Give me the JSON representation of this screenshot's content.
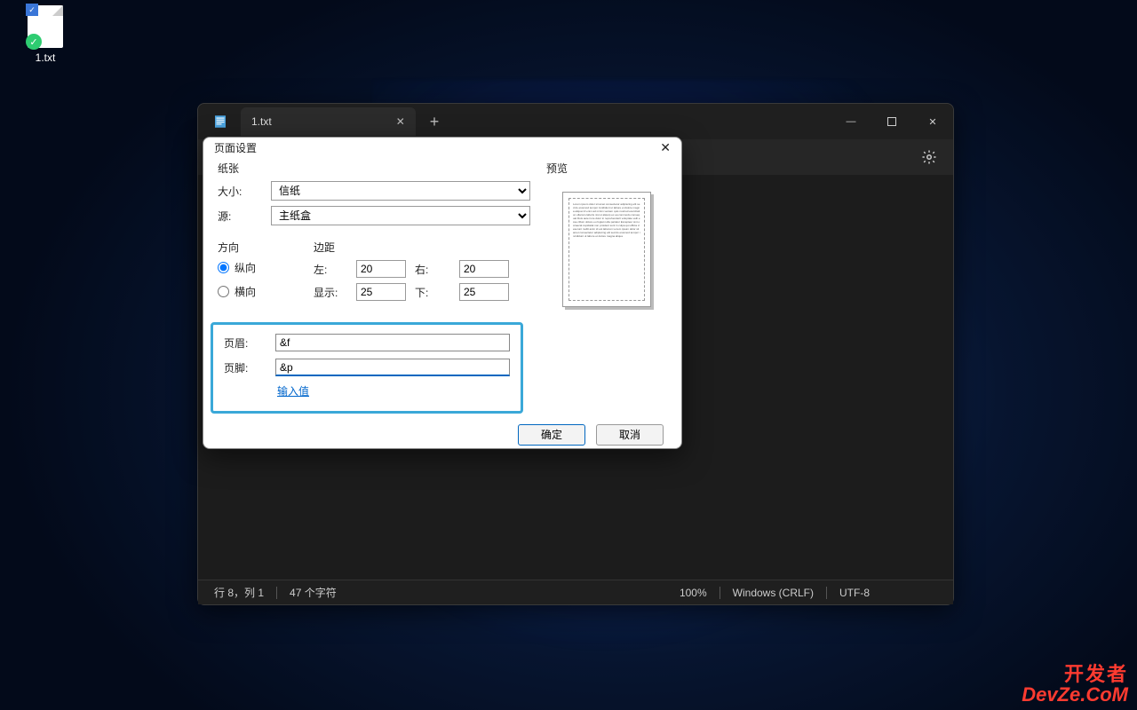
{
  "desktop": {
    "file_icon_label": "1.txt"
  },
  "notepad": {
    "tab_title": "1.txt",
    "tab_close": "✕",
    "new_tab": "+",
    "win": {
      "min": "—",
      "close": "✕"
    },
    "status": {
      "cursor": "行 8，列 1",
      "chars": "47 个字符",
      "zoom": "100%",
      "eol": "Windows (CRLF)",
      "encoding": "UTF-8"
    }
  },
  "dialog": {
    "title": "页面设置",
    "paper": {
      "group": "纸张",
      "size_label": "大小:",
      "size_value": "信纸",
      "source_label": "源:",
      "source_value": "主纸盒"
    },
    "orientation": {
      "group": "方向",
      "portrait": "纵向",
      "landscape": "横向"
    },
    "margins": {
      "group": "边距",
      "left_label": "左:",
      "left_value": "20",
      "right_label": "右:",
      "right_value": "20",
      "top_label": "显示:",
      "top_value": "25",
      "bottom_label": "下:",
      "bottom_value": "25"
    },
    "header_label": "页眉:",
    "header_value": "&f",
    "footer_label": "页脚:",
    "footer_value": "&p",
    "input_link": "输入值",
    "preview_label": "预览",
    "ok": "确定",
    "cancel": "取消"
  },
  "watermark": {
    "line1": "开发者",
    "line2": "DevZe.CoM"
  }
}
